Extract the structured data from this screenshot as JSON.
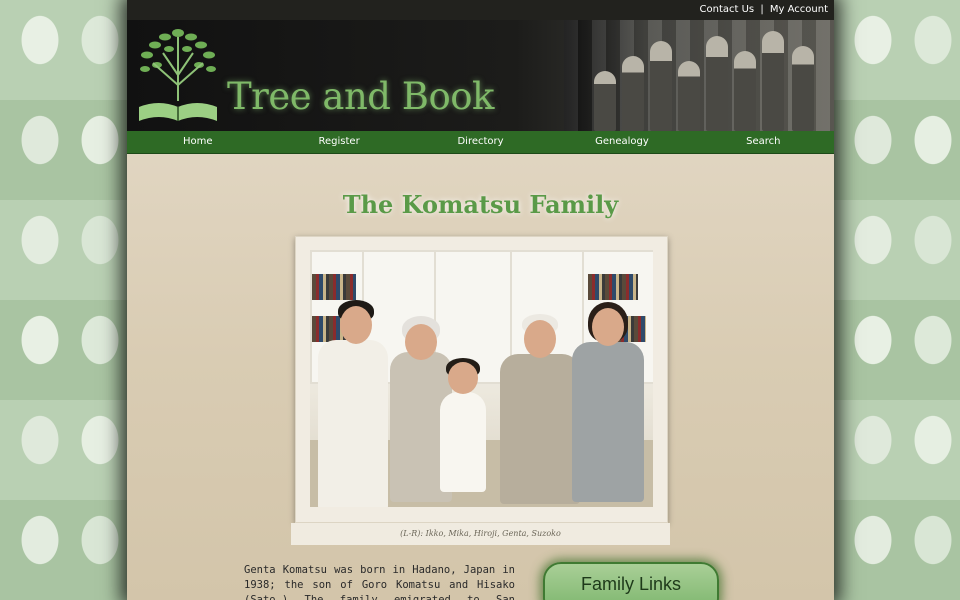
{
  "topbar": {
    "contact": "Contact Us",
    "separator": "|",
    "account": "My Account"
  },
  "header": {
    "site_title": "Tree and Book",
    "logo_icon": "tree-and-book-icon"
  },
  "nav": {
    "items": [
      "Home",
      "Register",
      "Directory",
      "Genealogy",
      "Search"
    ]
  },
  "main": {
    "title": "The Komatsu Family",
    "photo_caption": "(L-R): Ikko, Mika, Hiroji, Genta, Suzoko",
    "bio": "Genta Komatsu was born in Hadano, Japan in 1938; the son of Goro Komatsu and Hisako (Sato.) The family emigrated to San Francisco in",
    "family_links_label": "Family Links"
  },
  "colors": {
    "nav": "#2e6a25",
    "title_green": "#5a9a48",
    "logo_green": "#7fb968"
  }
}
